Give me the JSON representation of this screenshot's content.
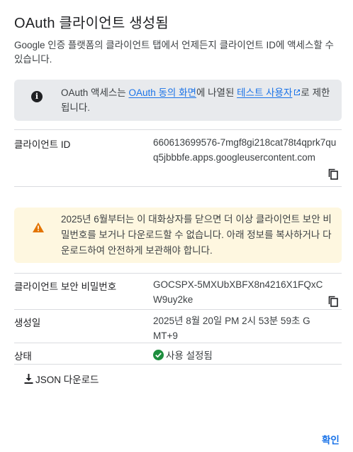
{
  "dialog": {
    "title": "OAuth 클라이언트 생성됨",
    "description": "Google 인증 플랫폼의 클라이언트 탭에서 언제든지 클라이언트 ID에 액세스할 수 있습니다."
  },
  "info_banner": {
    "text_prefix": "OAuth 액세스는 ",
    "consent_link": "OAuth 동의 화면",
    "text_middle": "에 나열된 ",
    "test_users_link": "테스트 사용자",
    "text_suffix": "로 제한됩니다."
  },
  "client_id": {
    "label": "클라이언트 ID",
    "value": "660613699576-7mgf8gi218cat78t4qprk7quq5jbbbfe.apps.googleusercontent.com"
  },
  "warning_banner": {
    "text": "2025년 6월부터는 이 대화상자를 닫으면 더 이상 클라이언트 보안 비밀번호를 보거나 다운로드할 수 없습니다. 아래 정보를 복사하거나 다운로드하여 안전하게 보관해야 합니다."
  },
  "client_secret": {
    "label": "클라이언트 보안 비밀번호",
    "value": "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"
  },
  "created": {
    "label": "생성일",
    "value": "2025년 8월 20일 PM 2시 53분 59초 GMT+9"
  },
  "state": {
    "label": "상태",
    "value": "사용 설정됨"
  },
  "actions": {
    "download_label": "JSON 다운로드",
    "confirm_label": "확인"
  },
  "colors": {
    "accent": "#1a73e8",
    "success": "#1e8e3e",
    "warning": "#e37400",
    "info_bg": "#e8eaed",
    "warning_bg": "#fef7e0"
  },
  "icons": {
    "info": "info-icon",
    "warning": "warning-icon",
    "copy": "copy-icon",
    "check": "check-circle-icon",
    "download": "download-icon",
    "external": "external-link-icon"
  }
}
